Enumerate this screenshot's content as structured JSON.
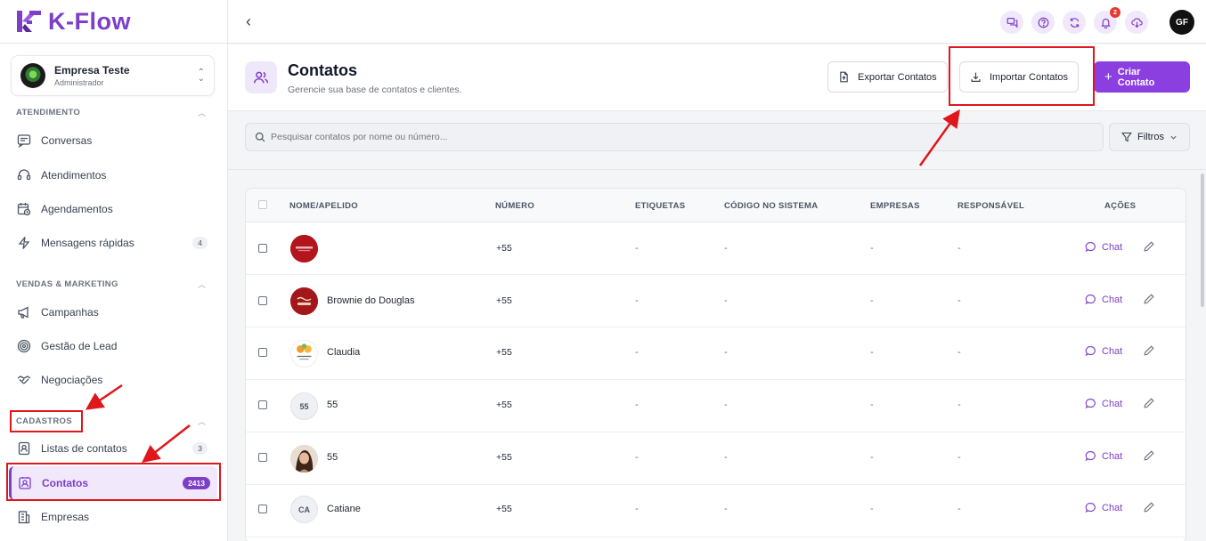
{
  "app": {
    "brand": "K-Flow",
    "brand_color": "#7c3fc6"
  },
  "company": {
    "name": "Empresa Teste",
    "role": "Administrador"
  },
  "sidebar": {
    "sections": [
      {
        "title": "ATENDIMENTO"
      },
      {
        "title": "VENDAS & MARKETING"
      },
      {
        "title": "CADASTROS"
      }
    ],
    "items": [
      {
        "label": "Conversas",
        "icon": "chat-lines-icon"
      },
      {
        "label": "Atendimentos",
        "icon": "headset-icon"
      },
      {
        "label": "Agendamentos",
        "icon": "calendar-clock-icon"
      },
      {
        "label": "Mensagens rápidas",
        "icon": "lightning-icon",
        "badge": "4"
      },
      {
        "label": "Campanhas",
        "icon": "megaphone-icon"
      },
      {
        "label": "Gestão de Lead",
        "icon": "target-icon"
      },
      {
        "label": "Negociações",
        "icon": "handshake-icon"
      },
      {
        "label": "Listas de contatos",
        "icon": "contact-list-icon",
        "badge": "3"
      },
      {
        "label": "Contatos",
        "icon": "contact-card-icon",
        "badge": "2413",
        "active": true
      },
      {
        "label": "Empresas",
        "icon": "building-icon"
      }
    ]
  },
  "topbar": {
    "icons": [
      "messages-icon",
      "help-icon",
      "refresh-icon",
      "bell-icon",
      "cloud-download-icon"
    ],
    "notification_count": "2",
    "user_initials": "GF"
  },
  "header": {
    "title": "Contatos",
    "subtitle": "Gerencie sua base de contatos e clientes.",
    "export_label": "Exportar Contatos",
    "import_label": "Importar Contatos",
    "create_label": "Criar Contato"
  },
  "search": {
    "placeholder": "Pesquisar contatos por nome ou número...",
    "filter_label": "Filtros"
  },
  "table": {
    "columns": [
      "NOME/APELIDO",
      "NÚMERO",
      "ETIQUETAS",
      "CÓDIGO NO SISTEMA",
      "EMPRESAS",
      "RESPONSÁVEL",
      "AÇÕES"
    ],
    "chat_label": "Chat",
    "rows": [
      {
        "name": "",
        "avatar": "image-red-logo",
        "number": "+55",
        "tags": "-",
        "code": "-",
        "companies": "-",
        "owner": "-"
      },
      {
        "name": "Brownie do Douglas",
        "avatar": "image-brownie-logo",
        "number": "+55",
        "tags": "-",
        "code": "-",
        "companies": "-",
        "owner": "-"
      },
      {
        "name": "Claudia",
        "avatar": "image-flower-logo",
        "number": "+55",
        "tags": "-",
        "code": "-",
        "companies": "-",
        "owner": "-"
      },
      {
        "name": "55",
        "avatar_initials": "55",
        "number": "+55",
        "tags": "-",
        "code": "-",
        "companies": "-",
        "owner": "-"
      },
      {
        "name": "55",
        "avatar": "image-person-photo",
        "number": "+55",
        "tags": "-",
        "code": "-",
        "companies": "-",
        "owner": "-"
      },
      {
        "name": "Catiane",
        "avatar_initials": "CA",
        "number": "+55",
        "tags": "-",
        "code": "-",
        "companies": "-",
        "owner": "-"
      }
    ]
  },
  "colors": {
    "accent": "#7c3fc6",
    "primary_button": "#8b3fe0",
    "annotation_red": "#e0161d",
    "badge_red": "#e53935"
  }
}
